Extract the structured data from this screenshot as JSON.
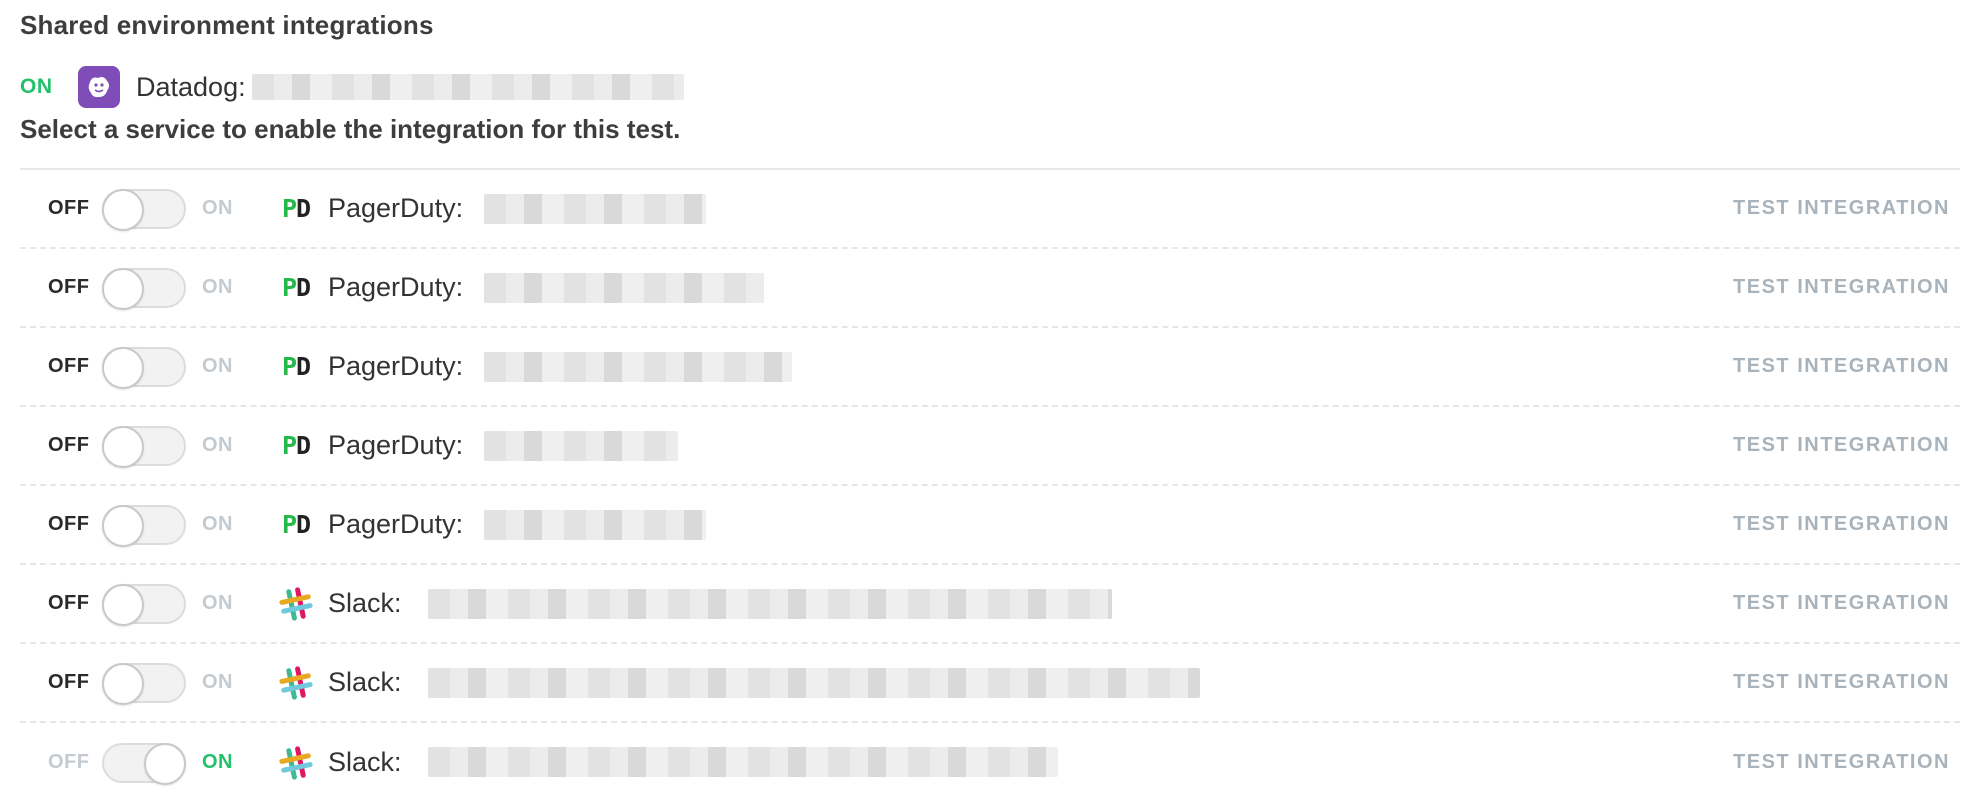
{
  "section_title": "Shared environment integrations",
  "shared": {
    "status": "ON",
    "service": "Datadog:",
    "status_color": "#23c16b",
    "icon": "datadog-icon"
  },
  "instructions": "Select a service to enable the integration for this test.",
  "labels": {
    "off": "OFF",
    "on": "ON",
    "test": "TEST INTEGRATION"
  },
  "integrations": [
    {
      "service": "PagerDuty:",
      "icon": "pagerduty-icon",
      "enabled": false
    },
    {
      "service": "PagerDuty:",
      "icon": "pagerduty-icon",
      "enabled": false
    },
    {
      "service": "PagerDuty:",
      "icon": "pagerduty-icon",
      "enabled": false
    },
    {
      "service": "PagerDuty:",
      "icon": "pagerduty-icon",
      "enabled": false
    },
    {
      "service": "PagerDuty:",
      "icon": "pagerduty-icon",
      "enabled": false
    },
    {
      "service": "Slack:",
      "icon": "slack-icon",
      "enabled": false
    },
    {
      "service": "Slack:",
      "icon": "slack-icon",
      "enabled": false
    },
    {
      "service": "Slack:",
      "icon": "slack-icon",
      "enabled": true
    }
  ],
  "colors": {
    "accent_on": "#23c16b",
    "muted": "#a9b3bb",
    "pagerduty": "#25b84a",
    "datadog": "#7f4cb8"
  }
}
